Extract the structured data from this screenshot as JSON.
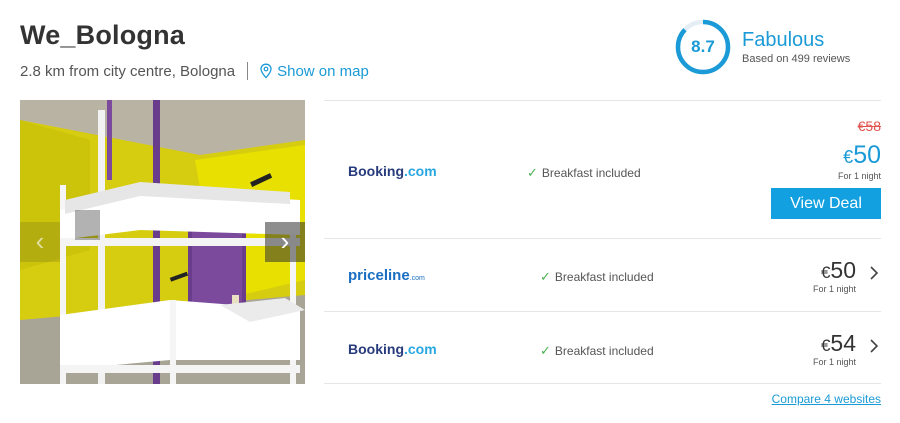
{
  "hotel": {
    "name": "We_Bologna",
    "distance": "2.8 km from city centre, Bologna",
    "map_link": "Show on map"
  },
  "rating": {
    "score": "8.7",
    "label": "Fabulous",
    "reviews": "Based on 499 reviews",
    "fill_fraction": 0.87
  },
  "colors": {
    "accent": "#1a9ad6",
    "button": "#12a0e0",
    "strike_price": "#e0524b",
    "check": "#4cb050"
  },
  "deals": [
    {
      "provider_main": "Booking",
      "provider_domain": ".com",
      "amenity": "Breakfast included",
      "old_price": "€58",
      "currency": "€",
      "price": "50",
      "per_night": "For 1 night",
      "cta": "View Deal"
    },
    {
      "provider_main": "priceline",
      "provider_domain": ".com",
      "amenity": "Breakfast included",
      "currency": "€",
      "price": "50",
      "per_night": "For 1 night"
    },
    {
      "provider_main": "Booking",
      "provider_domain": ".com",
      "amenity": "Breakfast included",
      "currency": "€",
      "price": "54",
      "per_night": "For 1 night"
    }
  ],
  "compare_link": "Compare 4 websites",
  "icons": {
    "map": "location-pin-icon",
    "prev": "chevron-left-icon",
    "next": "chevron-right-icon",
    "check": "checkmark-icon",
    "row_arrow": "chevron-right-icon"
  }
}
